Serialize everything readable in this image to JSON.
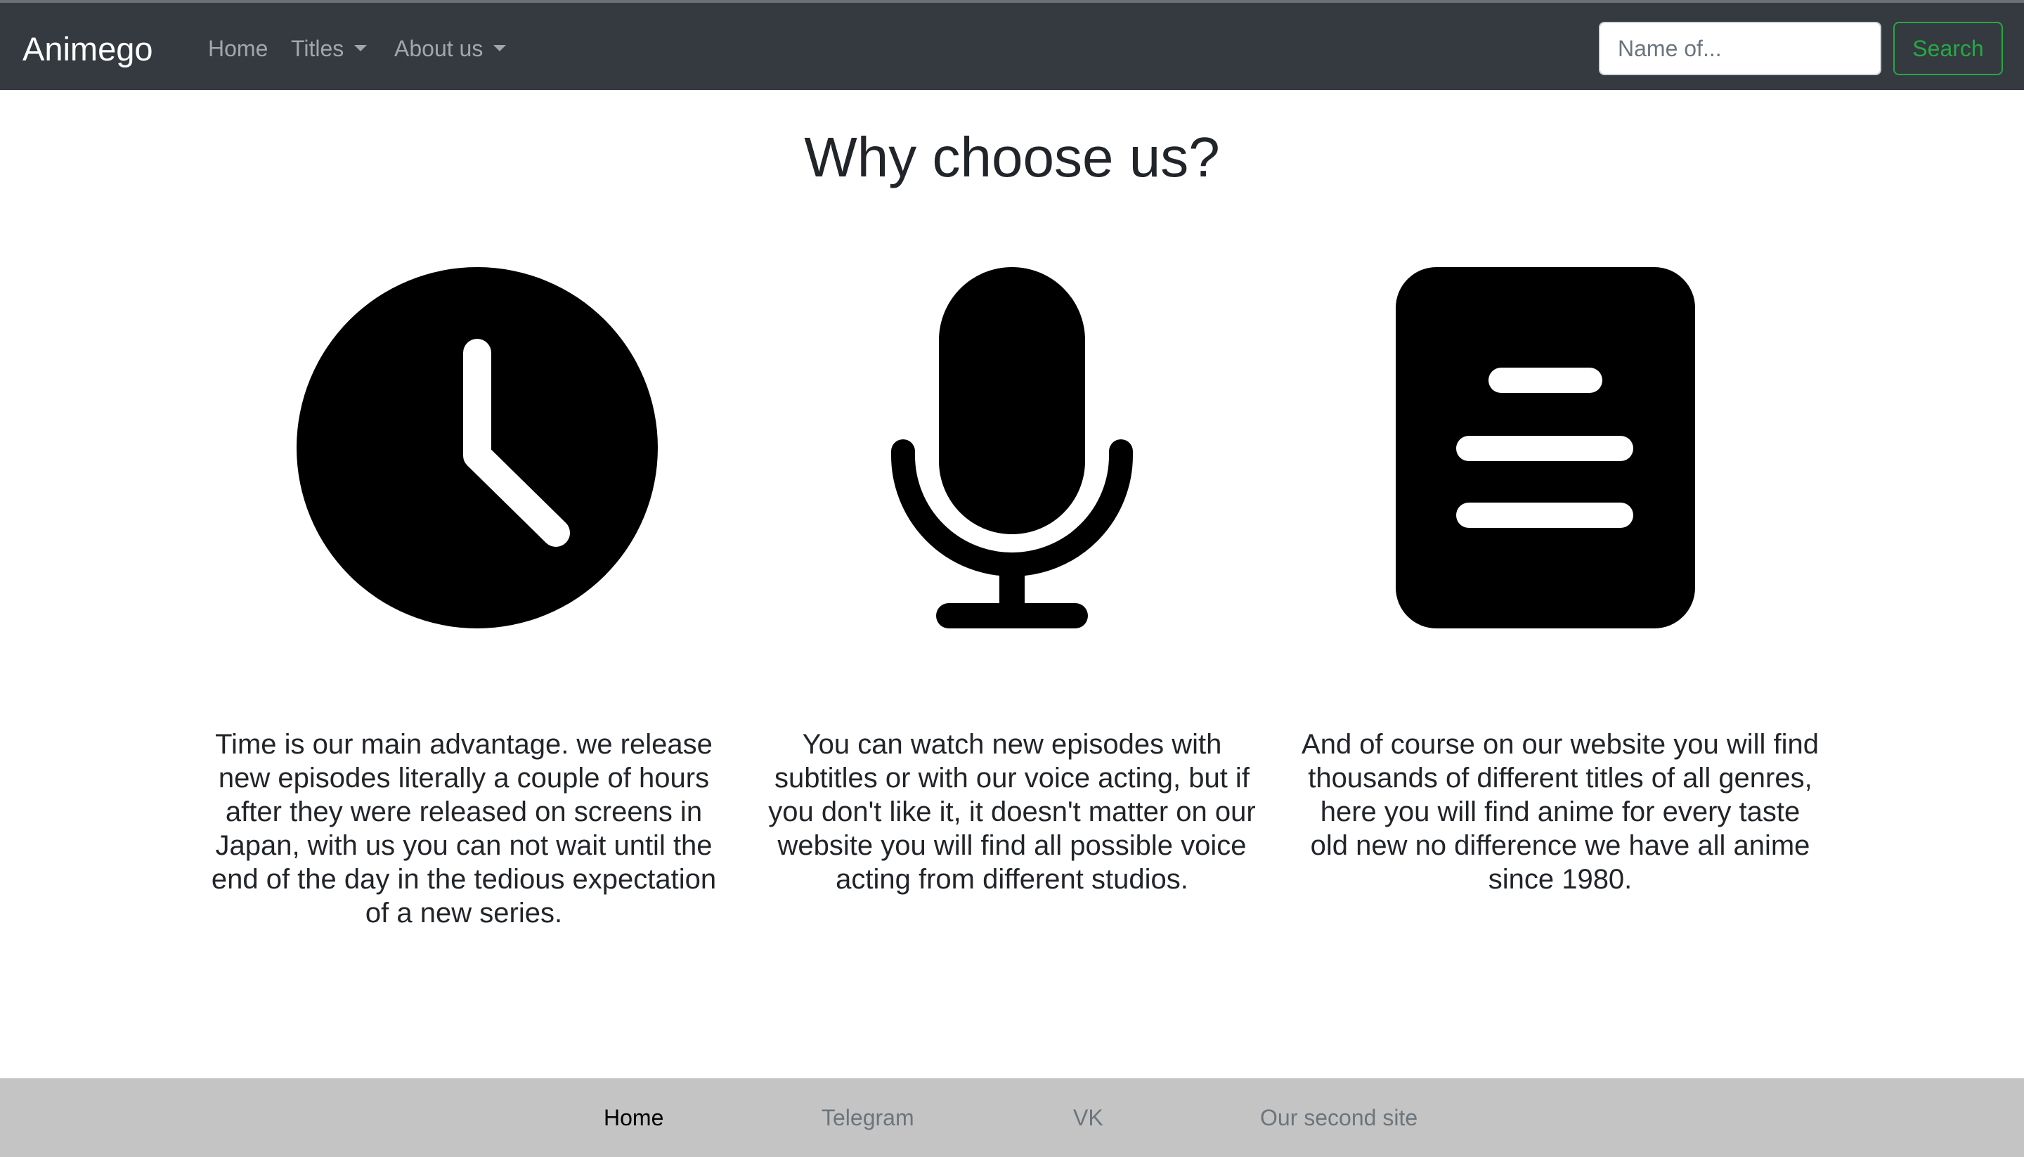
{
  "navbar": {
    "brand": "Animego",
    "links": [
      {
        "label": "Home"
      },
      {
        "label": "Titles",
        "dropdown": true
      },
      {
        "label": "About us",
        "dropdown": true
      }
    ],
    "search": {
      "placeholder": "Name of...",
      "value": "",
      "button_label": "Search"
    }
  },
  "main": {
    "title": "Why choose us?",
    "features": [
      {
        "icon": "clock-icon",
        "text": "Time is our main advantage. we release new episodes literally a couple of hours after they were released on screens in Japan, with us you can not wait until the end of the day in the tedious expectation of a new series."
      },
      {
        "icon": "microphone-icon",
        "text": "You can watch new episodes with subtitles or with our voice acting, but if you don't like it, it doesn't matter on our website you will find all possible voice acting from different studios."
      },
      {
        "icon": "document-icon",
        "text": "And of course on our website you will find thousands of different titles of all genres, here you will find anime for every taste old new no difference we have all anime since 1980."
      }
    ]
  },
  "footer": {
    "links": [
      {
        "label": "Home",
        "active": true
      },
      {
        "label": "Telegram"
      },
      {
        "label": "VK"
      },
      {
        "label": "Our second site"
      }
    ]
  },
  "colors": {
    "navbar_bg": "#343a40",
    "footer_bg": "#c4c4c4",
    "search_button": "#28a745"
  }
}
